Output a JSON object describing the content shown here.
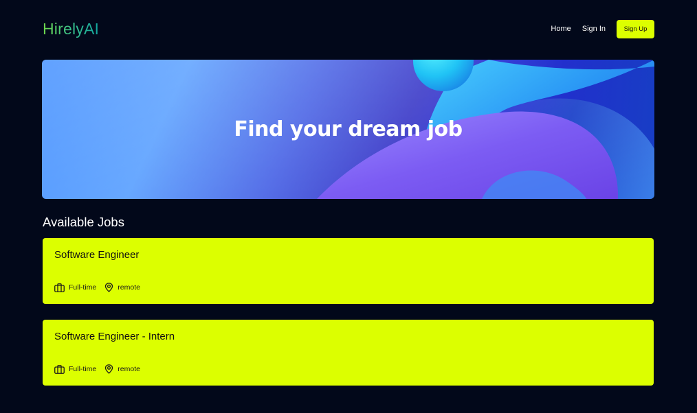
{
  "nav": {
    "logo": "HirelyAI",
    "links": [
      "Home",
      "Sign In"
    ],
    "signup_label": "Sign Up"
  },
  "hero": {
    "title": "Find your dream job"
  },
  "jobs_section": {
    "title": "Available Jobs",
    "jobs": [
      {
        "title": "Software Engineer",
        "type": "Full-time",
        "location": "remote"
      },
      {
        "title": "Software Engineer - Intern",
        "type": "Full-time",
        "location": "remote"
      }
    ]
  },
  "colors": {
    "background": "#02081a",
    "accent": "#dcff00",
    "logo_gradient_start": "#6fd84a",
    "logo_gradient_end": "#12a6a0"
  },
  "icons": {
    "job_type": "briefcase-icon",
    "location": "map-pin-icon"
  }
}
